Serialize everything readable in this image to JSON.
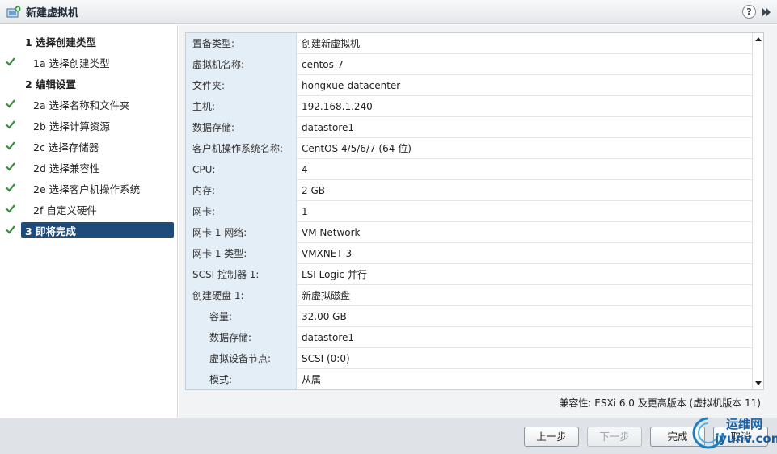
{
  "window": {
    "title": "新建虚拟机",
    "help_label": "?"
  },
  "steps": [
    {
      "number": "1",
      "label": "选择创建类型",
      "checked": false,
      "major": true
    },
    {
      "number": "1a",
      "label": "选择创建类型",
      "checked": true,
      "major": false
    },
    {
      "number": "2",
      "label": "编辑设置",
      "checked": false,
      "major": true
    },
    {
      "number": "2a",
      "label": "选择名称和文件夹",
      "checked": true,
      "major": false
    },
    {
      "number": "2b",
      "label": "选择计算资源",
      "checked": true,
      "major": false
    },
    {
      "number": "2c",
      "label": "选择存储器",
      "checked": true,
      "major": false
    },
    {
      "number": "2d",
      "label": "选择兼容性",
      "checked": true,
      "major": false
    },
    {
      "number": "2e",
      "label": "选择客户机操作系统",
      "checked": true,
      "major": false
    },
    {
      "number": "2f",
      "label": "自定义硬件",
      "checked": true,
      "major": false
    },
    {
      "number": "3",
      "label": "即将完成",
      "checked": true,
      "major": true,
      "active": true
    }
  ],
  "summary": [
    {
      "key": "置备类型:",
      "value": "创建新虚拟机"
    },
    {
      "key": "虚拟机名称:",
      "value": "centos-7"
    },
    {
      "key": "文件夹:",
      "value": "hongxue-datacenter"
    },
    {
      "key": "主机:",
      "value": "192.168.1.240"
    },
    {
      "key": "数据存储:",
      "value": "datastore1"
    },
    {
      "key": "客户机操作系统名称:",
      "value": "CentOS 4/5/6/7 (64 位)"
    },
    {
      "key": "CPU:",
      "value": "4"
    },
    {
      "key": "内存:",
      "value": "2 GB"
    },
    {
      "key": "网卡:",
      "value": "1"
    },
    {
      "key": "网卡 1 网络:",
      "value": "VM Network"
    },
    {
      "key": "网卡 1 类型:",
      "value": "VMXNET 3"
    },
    {
      "key": "SCSI 控制器 1:",
      "value": "LSI Logic 并行"
    },
    {
      "key": "创建硬盘 1:",
      "value": "新虚拟磁盘"
    },
    {
      "key": "容量:",
      "value": "32.00 GB",
      "sub": true
    },
    {
      "key": "数据存储:",
      "value": "datastore1",
      "sub": true
    },
    {
      "key": "虚拟设备节点:",
      "value": "SCSI (0:0)",
      "sub": true
    },
    {
      "key": "模式:",
      "value": "从属",
      "sub": true
    }
  ],
  "compatibility": "兼容性: ESXi 6.0 及更高版本 (虚拟机版本 11)",
  "buttons": {
    "back": "上一步",
    "next": "下一步",
    "finish": "完成",
    "cancel": "取消"
  },
  "watermark": {
    "line1": "运维网",
    "line2": "iyunv.com"
  },
  "colors": {
    "active_step": "#1e4b7a",
    "check": "#3a8f3a",
    "key_bg": "#e4eef7"
  }
}
